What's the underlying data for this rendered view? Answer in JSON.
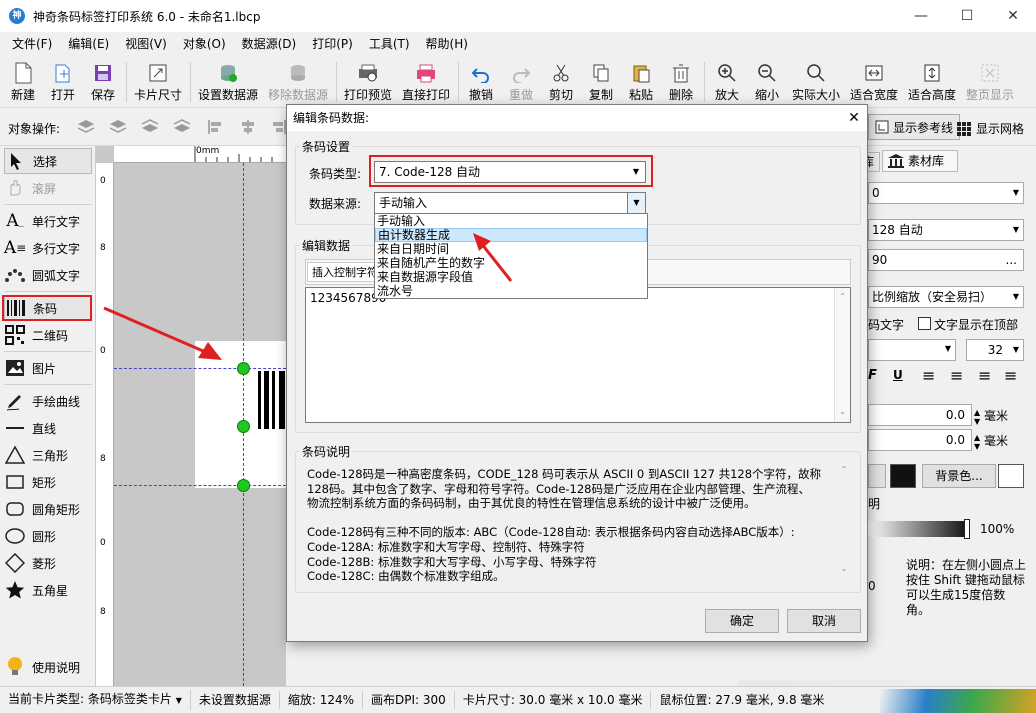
{
  "window": {
    "title": "神奇条码标签打印系统 6.0 - 未命名1.lbcp",
    "app_icon": "神"
  },
  "menu": [
    "文件(F)",
    "编辑(E)",
    "视图(V)",
    "对象(O)",
    "数据源(D)",
    "打印(P)",
    "工具(T)",
    "帮助(H)"
  ],
  "toolbar": {
    "new": "新建",
    "open": "打开",
    "save": "保存",
    "card_size": "卡片尺寸",
    "set_datasource": "设置数据源",
    "remove_datasource": "移除数据源",
    "print_preview": "打印预览",
    "direct_print": "直接打印",
    "undo": "撤销",
    "redo": "重做",
    "cut": "剪切",
    "copy": "复制",
    "paste": "粘贴",
    "delete": "删除",
    "zoom_in": "放大",
    "zoom_out": "缩小",
    "actual_size": "实际大小",
    "fit_width": "适合宽度",
    "fit_height": "适合高度",
    "full_page": "整页显示"
  },
  "objbar": {
    "label": "对象操作:",
    "show_guides": "显示参考线",
    "show_grid": "显示网格"
  },
  "tools": {
    "select": "选择",
    "scroll": "滚屏",
    "single_text": "单行文字",
    "multi_text": "多行文字",
    "arc_text": "圆弧文字",
    "barcode": "条码",
    "qrcode": "二维码",
    "image": "图片",
    "freehand": "手绘曲线",
    "line": "直线",
    "triangle": "三角形",
    "rect": "矩形",
    "round_rect": "圆角矩形",
    "circle": "圆形",
    "diamond": "菱形",
    "star": "五角星",
    "help": "使用说明"
  },
  "ruler": {
    "h0": "0mm",
    "v0": "0",
    "v8a": "8",
    "v0b": "0",
    "v8b": "8",
    "v0c": "0",
    "v8c": "8",
    "v0d": "0",
    "v8d": "8"
  },
  "right": {
    "tab1": "库",
    "tab2": "素材库",
    "r1": "0",
    "r2": "128 自动",
    "r3": "90",
    "r3_btn": "...",
    "r4": "比例缩放（安全易扫）",
    "r5": "码文字",
    "r5b": "文字显示在顶部",
    "fontsize": "32",
    "v1": "0.0",
    "unit1": "毫米",
    "v2": "0.0",
    "unit2": "毫米",
    "bg_btn": "背景色...",
    "r8": "明",
    "percent": "100%",
    "r9": "0",
    "note": "说明：在左侧小圆点上按住 Shift 键拖动鼠标可以生成15度倍数角。"
  },
  "status": {
    "card_type": "当前卡片类型: 条码标签类卡片",
    "datasource": "未设置数据源",
    "zoom": "缩放: 124%",
    "dpi": "画布DPI: 300",
    "card_size": "卡片尺寸: 30.0 毫米 x 10.0 毫米",
    "mouse": "鼠标位置: 27.9 毫米, 9.8 毫米"
  },
  "dialog": {
    "title": "编辑条码数据:",
    "close": "✕",
    "group_settings": "条码设置",
    "type_label": "条码类型:",
    "type_value": "7. Code-128 自动",
    "source_label": "数据来源:",
    "source_value": "手动输入",
    "source_options": [
      "手动输入",
      "由计数器生成",
      "来自日期时间",
      "来自随机产生的数字",
      "来自数据源字段值",
      "流水号"
    ],
    "group_edit": "编辑数据",
    "insert_ctrl": "插入控制字符",
    "data_value": "1234567890",
    "group_desc": "条码说明",
    "desc_lines": [
      "Code-128码是一种高密度条码，CODE_128 码可表示从 ASCII 0 到ASCII 127 共128个字符，故称",
      "128码。其中包含了数字、字母和符号字符。Code-128码是广泛应用在企业内部管理、生产流程、",
      "物流控制系统方面的条码码制，由于其优良的特性在管理信息系统的设计中被广泛使用。",
      "",
      "Code-128码有三种不同的版本: ABC（Code-128自动: 表示根据条码内容自动选择ABC版本）:",
      "Code-128A: 标准数字和大写字母、控制符、特殊字符",
      "Code-128B: 标准数字和大写字母、小写字母、特殊字符",
      "Code-128C: 由偶数个标准数字组成。"
    ],
    "ok": "确定",
    "cancel": "取消"
  },
  "colors": {
    "accent_red": "#e02020",
    "handle_green": "#1ec81e",
    "highlight": "#cce8ff"
  }
}
